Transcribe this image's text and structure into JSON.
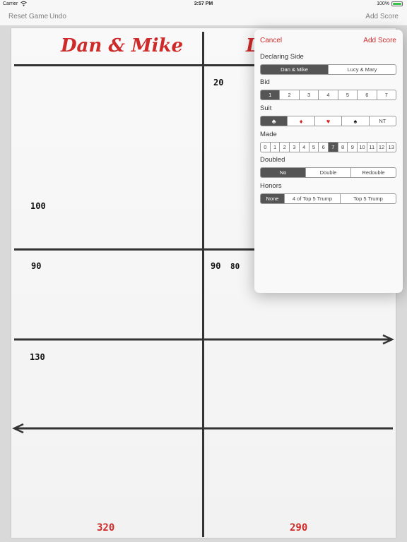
{
  "status_bar": {
    "carrier": "Carrier",
    "wifi_icon": "wifi-icon",
    "time": "3:57 PM",
    "battery_percent": "100%",
    "battery_level": 1.0
  },
  "nav_bar": {
    "reset_game": "Reset Game",
    "undo": "Undo",
    "add_score": "Add Score"
  },
  "score_sheet": {
    "team_left": "Dan & Mike",
    "team_right": "L",
    "scores": {
      "right_top": "20",
      "left_above_line": "100",
      "left_below_1": "90",
      "right_below_1": "90",
      "right_below_2": "80",
      "left_rubber": "130"
    },
    "totals": {
      "left": "320",
      "right": "290"
    },
    "colors": {
      "team_name": "#cf2a2a",
      "line": "#333333"
    }
  },
  "add_score_popover": {
    "cancel": "Cancel",
    "add_score": "Add Score",
    "declaring_side": {
      "label": "Declaring Side",
      "options": [
        "Dan & Mike",
        "Lucy & Mary"
      ],
      "selected": 0
    },
    "bid": {
      "label": "Bid",
      "options": [
        "1",
        "2",
        "3",
        "4",
        "5",
        "6",
        "7"
      ],
      "selected": 0
    },
    "suit": {
      "label": "Suit",
      "options": [
        {
          "icon": "club-icon",
          "glyph": "♣"
        },
        {
          "icon": "diamond-icon",
          "glyph": "♦"
        },
        {
          "icon": "heart-icon",
          "glyph": "♥"
        },
        {
          "icon": "spade-icon",
          "glyph": "♠"
        },
        {
          "icon": "",
          "glyph": "NT"
        }
      ],
      "selected": 0
    },
    "made": {
      "label": "Made",
      "options": [
        "0",
        "1",
        "2",
        "3",
        "4",
        "5",
        "6",
        "7",
        "8",
        "9",
        "10",
        "11",
        "12",
        "13"
      ],
      "selected": 7
    },
    "doubled": {
      "label": "Doubled",
      "options": [
        "No",
        "Double",
        "Redouble"
      ],
      "selected": 0
    },
    "honors": {
      "label": "Honors",
      "options": [
        "None",
        "4 of Top 5 Trump",
        "Top 5 Trump"
      ],
      "selected": 0
    },
    "colors": {
      "accent": "#cf2a2a",
      "selected_segment": "#555555"
    }
  }
}
